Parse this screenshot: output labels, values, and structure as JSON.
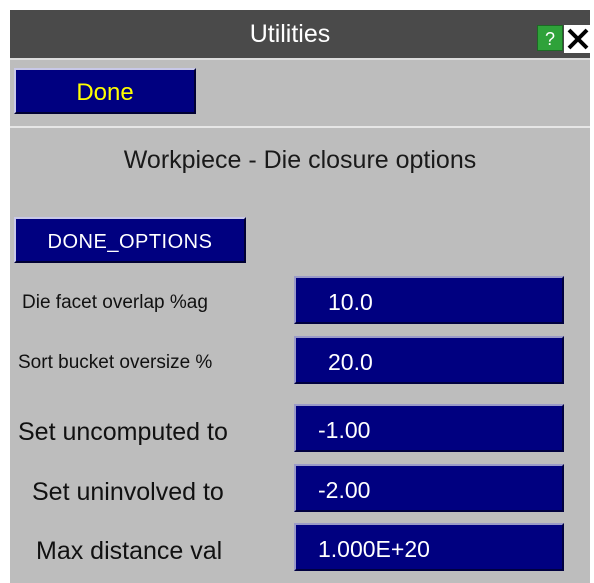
{
  "window": {
    "title": "Utilities",
    "help_label": "?",
    "close_icon": "close-icon"
  },
  "toolbar": {
    "done_label": "Done"
  },
  "panel": {
    "heading": "Workpiece - Die closure options",
    "options_button_label": "DONE_OPTIONS",
    "fields": [
      {
        "label": "Die facet overlap %ag",
        "value": "10.0"
      },
      {
        "label": "Sort bucket oversize %",
        "value": "20.0"
      },
      {
        "label": "Set uncomputed to",
        "value": "-1.00"
      },
      {
        "label": "Set uninvolved to",
        "value": "-2.00"
      },
      {
        "label": "Max distance val",
        "value": "1.000E+20"
      }
    ]
  },
  "colors": {
    "panel_bg": "#bdbdbd",
    "titlebar_bg": "#4a4a4a",
    "button_bg": "#000080",
    "done_text": "#ffff00",
    "help_bg": "#2fa23a"
  }
}
